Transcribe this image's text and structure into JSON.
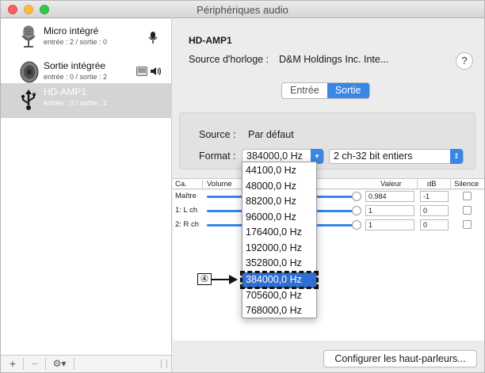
{
  "window": {
    "title": "Périphériques audio"
  },
  "sidebar": {
    "devices": [
      {
        "name": "Micro intégré",
        "io": "entrée : 2 / sortie : 0",
        "icon": "microphone-icon"
      },
      {
        "name": "Sortie intégrée",
        "io": "entrée : 0 / sortie : 2",
        "icon": "speaker-icon"
      },
      {
        "name": "HD-AMP1",
        "io": "entrée : 0 / sortie : 2",
        "icon": "usb-icon",
        "selected": true
      }
    ],
    "bottom_bar": {
      "add": "+",
      "remove": "−",
      "gear": "⚙▾"
    }
  },
  "main": {
    "device_title": "HD-AMP1",
    "clock_label": "Source d'horloge :",
    "clock_value": "D&M Holdings Inc. Inte...",
    "help": "?",
    "tabs": [
      {
        "label": "Entrée"
      },
      {
        "label": "Sortie",
        "selected": true
      }
    ],
    "source_label": "Source :",
    "source_value": "Par défaut",
    "format_label": "Format :",
    "format_rate": "384000,0 Hz",
    "format_depth": "2 ch-32 bit entiers",
    "table": {
      "headers": [
        "Ca.",
        "Volume",
        "Valeur",
        "dB",
        "Silence"
      ],
      "rows": [
        {
          "channel": "Maître",
          "value": "0.984",
          "db": "-1"
        },
        {
          "channel": "1: L ch",
          "value": "1",
          "db": "0"
        },
        {
          "channel": "2: R ch",
          "value": "1",
          "db": "0"
        }
      ]
    },
    "configure_button": "Configurer les haut-parleurs..."
  },
  "rate_menu": {
    "options": [
      "44100,0 Hz",
      "48000,0 Hz",
      "88200,0 Hz",
      "96000,0 Hz",
      "176400,0 Hz",
      "192000,0 Hz",
      "352800,0 Hz",
      "384000,0 Hz",
      "705600,0 Hz",
      "768000,0 Hz"
    ],
    "highlighted_index": 7
  },
  "callout": {
    "label": "④"
  },
  "colors": {
    "accent": "#3a86e6",
    "highlight": "#2f6fd3"
  }
}
